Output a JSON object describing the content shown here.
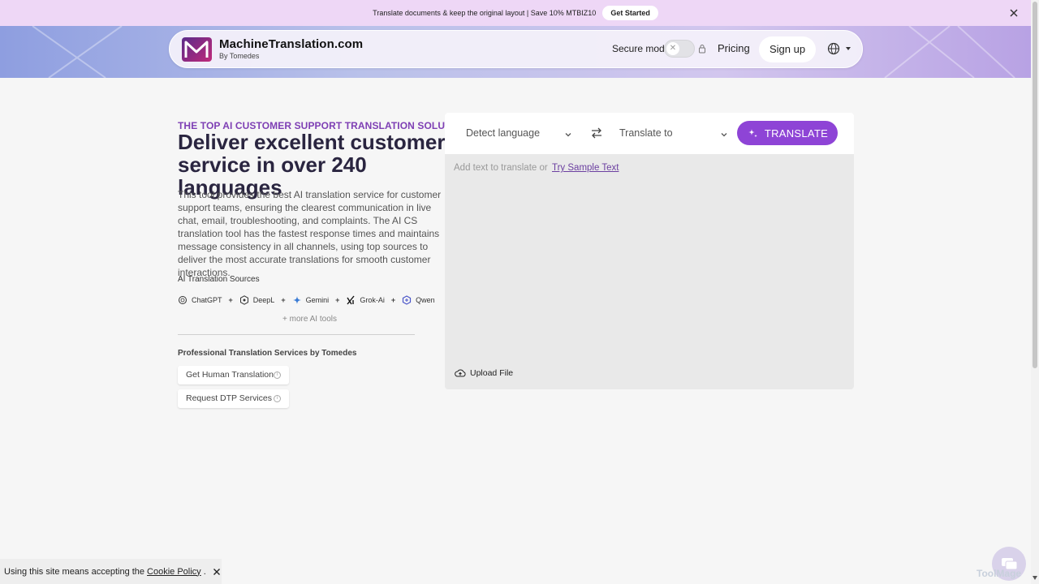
{
  "promo": {
    "message": "Translate documents & keep the original layout | Save 10% MTBIZ10",
    "cta": "Get Started"
  },
  "header": {
    "brand_name": "MachineTranslation.com",
    "brand_by": "By Tomedes",
    "secure_mode_label": "Secure mode",
    "pricing": "Pricing",
    "signup": "Sign up"
  },
  "hero": {
    "eyebrow": "THE TOP AI CUSTOMER SUPPORT TRANSLATION SOLUTION",
    "headline": "Deliver excellent customer service in over 240 languages",
    "description": "This tool provides the best AI translation service for customer support teams, ensuring the clearest communication in live chat, email, troubleshooting, and complaints. The AI CS translation tool has the fastest response times and maintains message consistency in all channels, using top sources to deliver the most accurate translations for smooth customer interactions."
  },
  "sources": {
    "title": "AI Translation Sources",
    "items": [
      "ChatGPT",
      "DeepL",
      "Gemini",
      "Grok-Ai",
      "Qwen"
    ],
    "more": "+ more AI tools"
  },
  "pro_services": {
    "title": "Professional Translation Services by Tomedes",
    "buttons": [
      "Get Human Translation",
      "Request DTP Services"
    ]
  },
  "translator": {
    "source_lang": "Detect language",
    "target_lang": "Translate to",
    "translate_button": "TRANSLATE",
    "placeholder": "Add text to translate or",
    "sample_link": "Try Sample Text",
    "upload": "Upload File"
  },
  "cookie": {
    "text": "Using this site means accepting the",
    "link": "Cookie Policy",
    "suffix": "."
  },
  "watermark": "ToolMage",
  "colors": {
    "accent": "#8e44d6",
    "eyebrow": "#7e3fb4",
    "promo_bg": "#eed7f6"
  }
}
